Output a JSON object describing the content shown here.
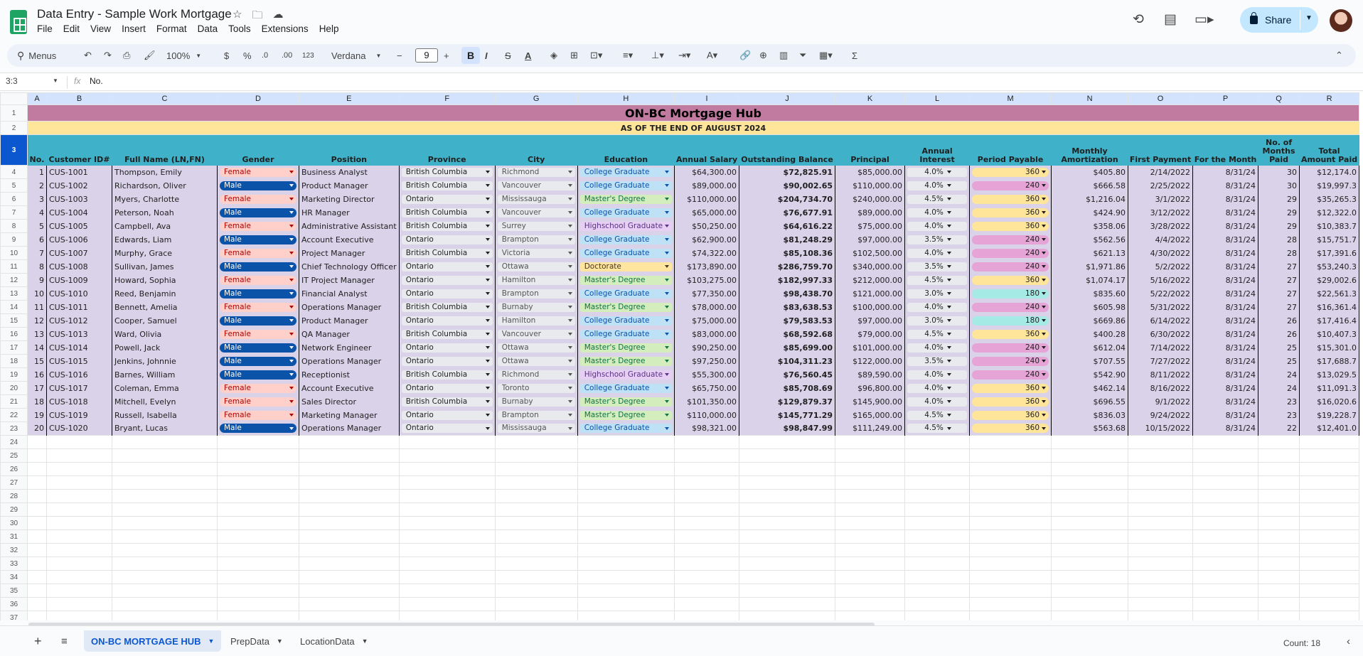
{
  "app": {
    "doc_title": "Data Entry - Sample Work Mortgage",
    "menus": [
      "File",
      "Edit",
      "View",
      "Insert",
      "Format",
      "Data",
      "Tools",
      "Extensions",
      "Help"
    ],
    "share_label": "Share"
  },
  "toolbar": {
    "search": "Menus",
    "zoom": "100%",
    "currency": "$",
    "percent": "%",
    "dec_minus": ".0",
    "dec_plus": ".00",
    "number_fmt": "123",
    "font": "Verdana",
    "font_size": "9",
    "bold": "B"
  },
  "formula": {
    "cell_ref": "3:3",
    "fx": "fx",
    "value": "No."
  },
  "columns": [
    "A",
    "B",
    "C",
    "D",
    "E",
    "F",
    "G",
    "H",
    "I",
    "J",
    "K",
    "L",
    "M",
    "N",
    "O",
    "P",
    "Q",
    "R"
  ],
  "sheet": {
    "title": "ON-BC Mortgage Hub",
    "subtitle": "AS OF THE END OF AUGUST 2024",
    "headers": [
      "No.",
      "Customer ID#",
      "Full Name (LN,FN)",
      "Gender",
      "Position",
      "Province",
      "City",
      "Education",
      "Annual Salary",
      "Outstanding Balance",
      "Principal",
      "Annual Interest",
      "Period Payable",
      "Monthly Amortization",
      "First Payment",
      "For the Month",
      "No. of Months Paid",
      "Total Amount Paid"
    ],
    "rows": [
      [
        "1",
        "CUS-1001",
        "Thompson, Emily",
        "Female",
        "Business Analyst",
        "British Columbia",
        "Richmond",
        "College Graduate",
        "$64,300.00",
        "$72,825.91",
        "$85,000.00",
        "4.0%",
        "360",
        "$405.80",
        "2/14/2022",
        "8/31/24",
        "30",
        "$12,174.0"
      ],
      [
        "2",
        "CUS-1002",
        "Richardson, Oliver",
        "Male",
        "Product Manager",
        "British Columbia",
        "Vancouver",
        "College Graduate",
        "$89,000.00",
        "$90,002.65",
        "$110,000.00",
        "4.0%",
        "240",
        "$666.58",
        "2/25/2022",
        "8/31/24",
        "30",
        "$19,997.3"
      ],
      [
        "3",
        "CUS-1003",
        "Myers, Charlotte",
        "Female",
        "Marketing Director",
        "Ontario",
        "Mississauga",
        "Master's Degree",
        "$110,000.00",
        "$204,734.70",
        "$240,000.00",
        "4.5%",
        "360",
        "$1,216.04",
        "3/1/2022",
        "8/31/24",
        "29",
        "$35,265.3"
      ],
      [
        "4",
        "CUS-1004",
        "Peterson, Noah",
        "Male",
        "HR Manager",
        "British Columbia",
        "Vancouver",
        "College Graduate",
        "$65,000.00",
        "$76,677.91",
        "$89,000.00",
        "4.0%",
        "360",
        "$424.90",
        "3/12/2022",
        "8/31/24",
        "29",
        "$12,322.0"
      ],
      [
        "5",
        "CUS-1005",
        "Campbell, Ava",
        "Female",
        "Administrative Assistant",
        "British Columbia",
        "Surrey",
        "Highschool Graduate",
        "$50,250.00",
        "$64,616.22",
        "$75,000.00",
        "4.0%",
        "360",
        "$358.06",
        "3/28/2022",
        "8/31/24",
        "29",
        "$10,383.7"
      ],
      [
        "6",
        "CUS-1006",
        "Edwards, Liam",
        "Male",
        "Account Executive",
        "Ontario",
        "Brampton",
        "College Graduate",
        "$62,900.00",
        "$81,248.29",
        "$97,000.00",
        "3.5%",
        "240",
        "$562.56",
        "4/4/2022",
        "8/31/24",
        "28",
        "$15,751.7"
      ],
      [
        "7",
        "CUS-1007",
        "Murphy, Grace",
        "Female",
        "Project Manager",
        "British Columbia",
        "Victoria",
        "College Graduate",
        "$74,322.00",
        "$85,108.36",
        "$102,500.00",
        "4.0%",
        "240",
        "$621.13",
        "4/30/2022",
        "8/31/24",
        "28",
        "$17,391.6"
      ],
      [
        "8",
        "CUS-1008",
        "Sullivan, James",
        "Male",
        "Chief Technology Officer",
        "Ontario",
        "Ottawa",
        "Doctorate",
        "$173,890.00",
        "$286,759.70",
        "$340,000.00",
        "3.5%",
        "240",
        "$1,971.86",
        "5/2/2022",
        "8/31/24",
        "27",
        "$53,240.3"
      ],
      [
        "9",
        "CUS-1009",
        "Howard, Sophia",
        "Female",
        "IT Project Manager",
        "Ontario",
        "Hamilton",
        "Master's Degree",
        "$103,275.00",
        "$182,997.33",
        "$212,000.00",
        "4.5%",
        "360",
        "$1,074.17",
        "5/16/2022",
        "8/31/24",
        "27",
        "$29,002.6"
      ],
      [
        "10",
        "CUS-1010",
        "Reed, Benjamin",
        "Male",
        "Financial Analyst",
        "Ontario",
        "Brampton",
        "College Graduate",
        "$77,350.00",
        "$98,438.70",
        "$121,000.00",
        "3.0%",
        "180",
        "$835.60",
        "5/22/2022",
        "8/31/24",
        "27",
        "$22,561.3"
      ],
      [
        "11",
        "CUS-1011",
        "Bennett, Amelia",
        "Female",
        "Operations Manager",
        "British Columbia",
        "Burnaby",
        "Master's Degree",
        "$78,000.00",
        "$83,638.53",
        "$100,000.00",
        "4.0%",
        "240",
        "$605.98",
        "5/31/2022",
        "8/31/24",
        "27",
        "$16,361.4"
      ],
      [
        "12",
        "CUS-1012",
        "Cooper, Samuel",
        "Male",
        "Product Manager",
        "Ontario",
        "Hamilton",
        "College Graduate",
        "$75,000.00",
        "$79,583.53",
        "$97,000.00",
        "3.0%",
        "180",
        "$669.86",
        "6/14/2022",
        "8/31/24",
        "26",
        "$17,416.4"
      ],
      [
        "13",
        "CUS-1013",
        "Ward, Olivia",
        "Female",
        "QA Manager",
        "British Columbia",
        "Vancouver",
        "College Graduate",
        "$83,000.00",
        "$68,592.68",
        "$79,000.00",
        "4.5%",
        "360",
        "$400.28",
        "6/30/2022",
        "8/31/24",
        "26",
        "$10,407.3"
      ],
      [
        "14",
        "CUS-1014",
        "Powell, Jack",
        "Male",
        "Network Engineer",
        "Ontario",
        "Ottawa",
        "Master's Degree",
        "$90,250.00",
        "$85,699.00",
        "$101,000.00",
        "4.0%",
        "240",
        "$612.04",
        "7/14/2022",
        "8/31/24",
        "25",
        "$15,301.0"
      ],
      [
        "15",
        "CUS-1015",
        "Jenkins, Johnnie",
        "Male",
        "Operations Manager",
        "Ontario",
        "Ottawa",
        "Master's Degree",
        "$97,250.00",
        "$104,311.23",
        "$122,000.00",
        "3.5%",
        "240",
        "$707.55",
        "7/27/2022",
        "8/31/24",
        "25",
        "$17,688.7"
      ],
      [
        "16",
        "CUS-1016",
        "Barnes, William",
        "Male",
        "Receptionist",
        "British Columbia",
        "Richmond",
        "Highschool Graduate",
        "$55,300.00",
        "$76,560.45",
        "$89,590.00",
        "4.0%",
        "240",
        "$542.90",
        "8/11/2022",
        "8/31/24",
        "24",
        "$13,029.5"
      ],
      [
        "17",
        "CUS-1017",
        "Coleman, Emma",
        "Female",
        "Account Executive",
        "Ontario",
        "Toronto",
        "College Graduate",
        "$65,750.00",
        "$85,708.69",
        "$96,800.00",
        "4.0%",
        "360",
        "$462.14",
        "8/16/2022",
        "8/31/24",
        "24",
        "$11,091.3"
      ],
      [
        "18",
        "CUS-1018",
        "Mitchell, Evelyn",
        "Female",
        "Sales Director",
        "British Columbia",
        "Burnaby",
        "Master's Degree",
        "$101,350.00",
        "$129,879.37",
        "$145,900.00",
        "4.0%",
        "360",
        "$696.55",
        "9/1/2022",
        "8/31/24",
        "23",
        "$16,020.6"
      ],
      [
        "19",
        "CUS-1019",
        "Russell, Isabella",
        "Female",
        "Marketing Manager",
        "Ontario",
        "Brampton",
        "Master's Degree",
        "$110,000.00",
        "$145,771.29",
        "$165,000.00",
        "4.5%",
        "360",
        "$836.03",
        "9/24/2022",
        "8/31/24",
        "23",
        "$19,228.7"
      ],
      [
        "20",
        "CUS-1020",
        "Bryant, Lucas",
        "Male",
        "Operations Manager",
        "Ontario",
        "Mississauga",
        "College Graduate",
        "$98,321.00",
        "$98,847.99",
        "$111,249.00",
        "4.5%",
        "360",
        "$563.68",
        "10/15/2022",
        "8/31/24",
        "22",
        "$12,401.0"
      ]
    ]
  },
  "tabs": [
    "ON-BC MORTGAGE HUB",
    "PrepData",
    "LocationData"
  ],
  "status": {
    "count": "Count: 18"
  },
  "colors": {
    "title_bg": "#c27ba0",
    "subtitle_bg": "#ffe599",
    "header_bg": "#3fb1c8",
    "row_bg": "#d9d2e9",
    "male": "#0a53a8",
    "female": "#ffcfc9"
  }
}
